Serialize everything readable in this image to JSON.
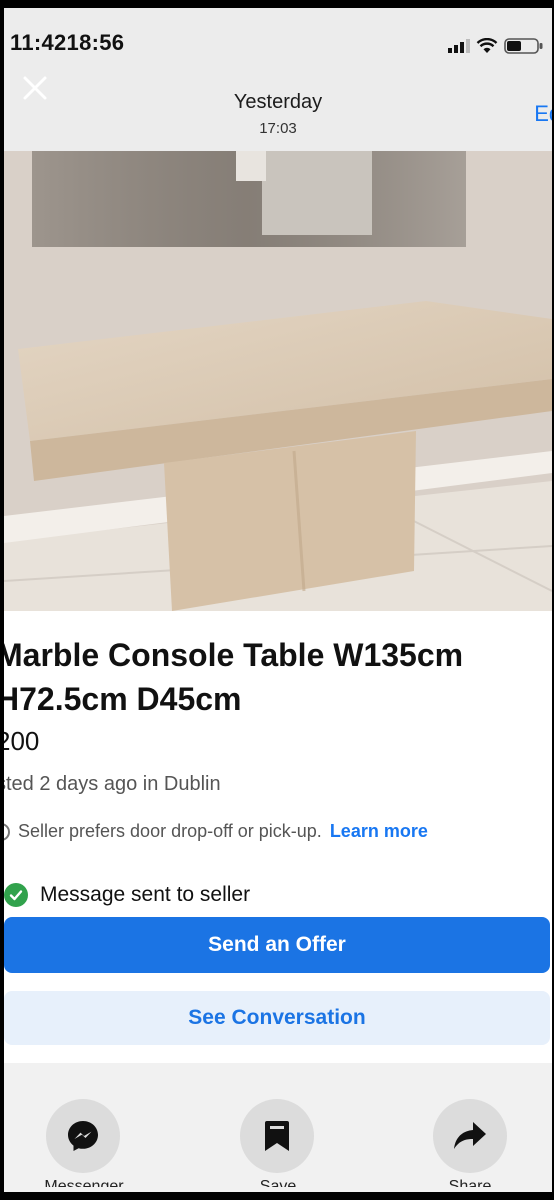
{
  "status_bar": {
    "time": "11:4218:56"
  },
  "header": {
    "title": "Yesterday",
    "subtitle": "17:03",
    "edit_label": "Edi"
  },
  "photo": {
    "image_count": 3,
    "active_index": 1
  },
  "listing": {
    "title_line1": "Marble Console Table W135cm",
    "title_line2": "H72.5cm D45cm",
    "price": "200",
    "listed": "sted 2 days ago in Dublin",
    "pref_text": "Seller prefers door drop-off or pick-up.",
    "learn_more": "Learn more"
  },
  "status": {
    "message_sent": "Message sent to seller"
  },
  "actions": {
    "send_offer": "Send an Offer",
    "see_conversation": "See Conversation"
  },
  "bottom_bar": {
    "messenger_label": "Messenger",
    "save_label": "Save",
    "share_label": "Share"
  },
  "colors": {
    "accent": "#1b74e4",
    "success": "#31a24c"
  },
  "icons": [
    "close-icon",
    "messenger-icon",
    "bookmark-icon",
    "share-icon",
    "check-icon",
    "info-icon"
  ]
}
